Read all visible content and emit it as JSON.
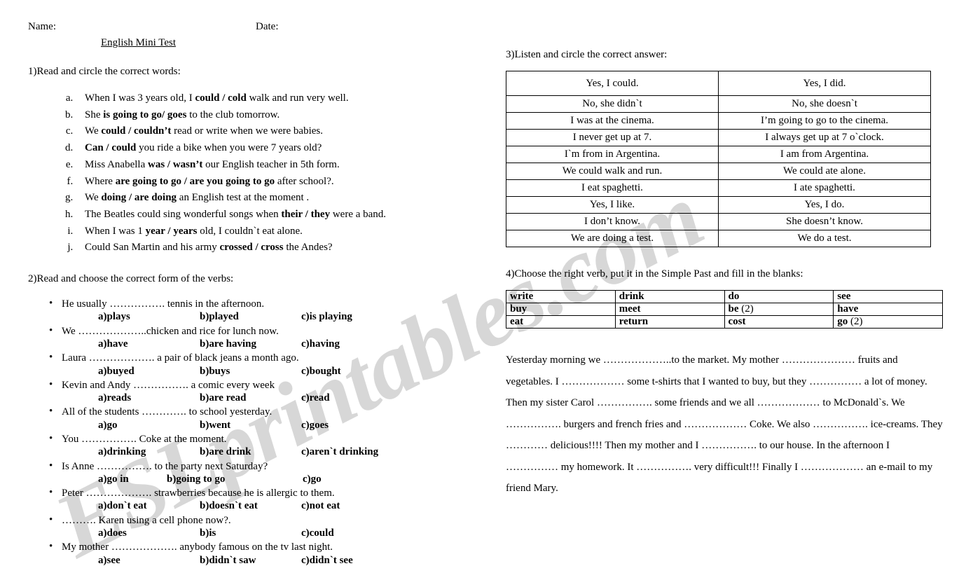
{
  "header": {
    "name_label": "Name:",
    "date_label": "Date:",
    "title": "English Mini Test"
  },
  "exercise1": {
    "heading": "1)Read and circle the correct words:",
    "items": [
      {
        "pre": "When I was 3 years old, I ",
        "bold": "could / cold",
        "post": " walk and run very well."
      },
      {
        "pre": "She ",
        "bold": "is going to go/ goes",
        "post": " to the club tomorrow."
      },
      {
        "pre": "We ",
        "bold": "could / couldn’t",
        "post": " read or write when we were babies."
      },
      {
        "pre": "",
        "bold": "Can / could",
        "post": " you ride a bike when you were 7 years old?"
      },
      {
        "pre": "Miss Anabella ",
        "bold": "was / wasn’t",
        "post": "  our English teacher in 5th form."
      },
      {
        "pre": "Where ",
        "bold": "are going to go / are you going to go",
        "post": "  after school?."
      },
      {
        "pre": "We ",
        "bold": "doing / are doing",
        "post": "  an English test at the moment ."
      },
      {
        "pre": "The Beatles could sing wonderful songs when ",
        "bold": "their / they",
        "post": " were a band."
      },
      {
        "pre": "When I was 1 ",
        "bold": "year / years",
        "post": " old, I couldn`t  eat alone."
      },
      {
        "pre": "Could San Martin and his army ",
        "bold": "crossed / cross",
        "post": " the Andes?"
      }
    ]
  },
  "exercise2": {
    "heading": "2)Read  and choose the correct form of the verbs:",
    "items": [
      {
        "question": "He usually ……………. tennis in the afternoon.",
        "a": "a)plays",
        "b": "b)played",
        "c": "c)is playing",
        "narrow": false
      },
      {
        "question": "We ………………..chicken and rice for lunch now.",
        "a": "a)have",
        "b": "b)are having",
        "c": "c)having",
        "narrow": false
      },
      {
        "question": "Laura ………………. a pair of black jeans a month ago.",
        "a": "a)buyed",
        "b": "b)buys",
        "c": "c)bought",
        "narrow": false
      },
      {
        "question": "Kevin and Andy ……………. a comic every week",
        "a": "a)reads",
        "b": "b)are read",
        "c": "c)read",
        "narrow": false
      },
      {
        "question": "All of the students ………….  to school yesterday.",
        "a": "a)go",
        "b": "b)went",
        "c": "c)goes",
        "narrow": false
      },
      {
        "question": "You ……………. Coke at the moment.",
        "a": "a)drinking",
        "b": "b)are drink",
        "c": "c)aren`t drinking",
        "narrow": false
      },
      {
        "question": "Is Anne ……………. to the party next Saturday?",
        "a": "a)go in",
        "b": "b)going to go",
        "c": "c)go",
        "narrow": true
      },
      {
        "question": "Peter ………………. strawberries because he is allergic to them.",
        "a": "a)don`t eat",
        "b": "b)doesn`t eat",
        "c": "c)not eat",
        "narrow": false
      },
      {
        "question": "………. Karen using a cell phone now?.",
        "a": "a)does",
        "b": "b)is",
        "c": "c)could",
        "narrow": false
      },
      {
        "question": "My mother ………………. anybody famous on the tv last night.",
        "a": "a)see",
        "b": "b)didn`t saw",
        "c": "c)didn`t see",
        "narrow": false
      }
    ]
  },
  "exercise3": {
    "heading": "3)Listen and circle the correct answer:",
    "rows": [
      {
        "left": "Yes, I could.",
        "right": "Yes, I did.",
        "tall": true
      },
      {
        "left": "No, she didn`t",
        "right": "No, she doesn`t",
        "tall": false
      },
      {
        "left": "I was at the cinema.",
        "right": "I’m going to go to the cinema.",
        "tall": false
      },
      {
        "left": "I never get up at 7.",
        "right": "I always get up at 7 o`clock.",
        "tall": false
      },
      {
        "left": "I`m from in Argentina.",
        "right": "I am from Argentina.",
        "tall": false
      },
      {
        "left": "We could walk and run.",
        "right": "We could ate alone.",
        "tall": false
      },
      {
        "left": "I eat spaghetti.",
        "right": "I ate spaghetti.",
        "tall": false
      },
      {
        "left": "Yes, I like.",
        "right": "Yes, I do.",
        "tall": false
      },
      {
        "left": "I don’t know.",
        "right": "She doesn’t know.",
        "tall": false
      },
      {
        "left": "We are doing a test.",
        "right": "We do a test.",
        "tall": false
      }
    ]
  },
  "exercise4": {
    "heading": "4)Choose the right verb, put it in the Simple Past and fill in the blanks:",
    "verb_rows": [
      [
        {
          "verb": "write",
          "count": ""
        },
        {
          "verb": "drink",
          "count": ""
        },
        {
          "verb": "do",
          "count": ""
        },
        {
          "verb": "see",
          "count": ""
        }
      ],
      [
        {
          "verb": "buy",
          "count": ""
        },
        {
          "verb": "meet",
          "count": ""
        },
        {
          "verb": "be",
          "count": " (2)"
        },
        {
          "verb": "have",
          "count": ""
        }
      ],
      [
        {
          "verb": "eat",
          "count": ""
        },
        {
          "verb": "return",
          "count": ""
        },
        {
          "verb": "cost",
          "count": ""
        },
        {
          "verb": "go",
          "count": " (2)"
        }
      ]
    ],
    "cloze_text": "Yesterday morning we ………………..to the market. My mother ………………… fruits and vegetables. I ……………… some t-shirts that I wanted to buy, but they …………… a lot of money. Then my sister Carol ……………. some friends and we all ……………… to McDonald`s. We ……………. burgers and french fries and  ……………… Coke. We also ……………. ice-creams. They ………… delicious!!!! Then my mother and I ……………. to our house. In the afternoon I …………… my homework. It ……………. very difficult!!! Finally I ……………… an e-mail to my friend Mary."
  },
  "watermark": {
    "text": "ESLprintables.com",
    "color": "#c9c9c9"
  }
}
